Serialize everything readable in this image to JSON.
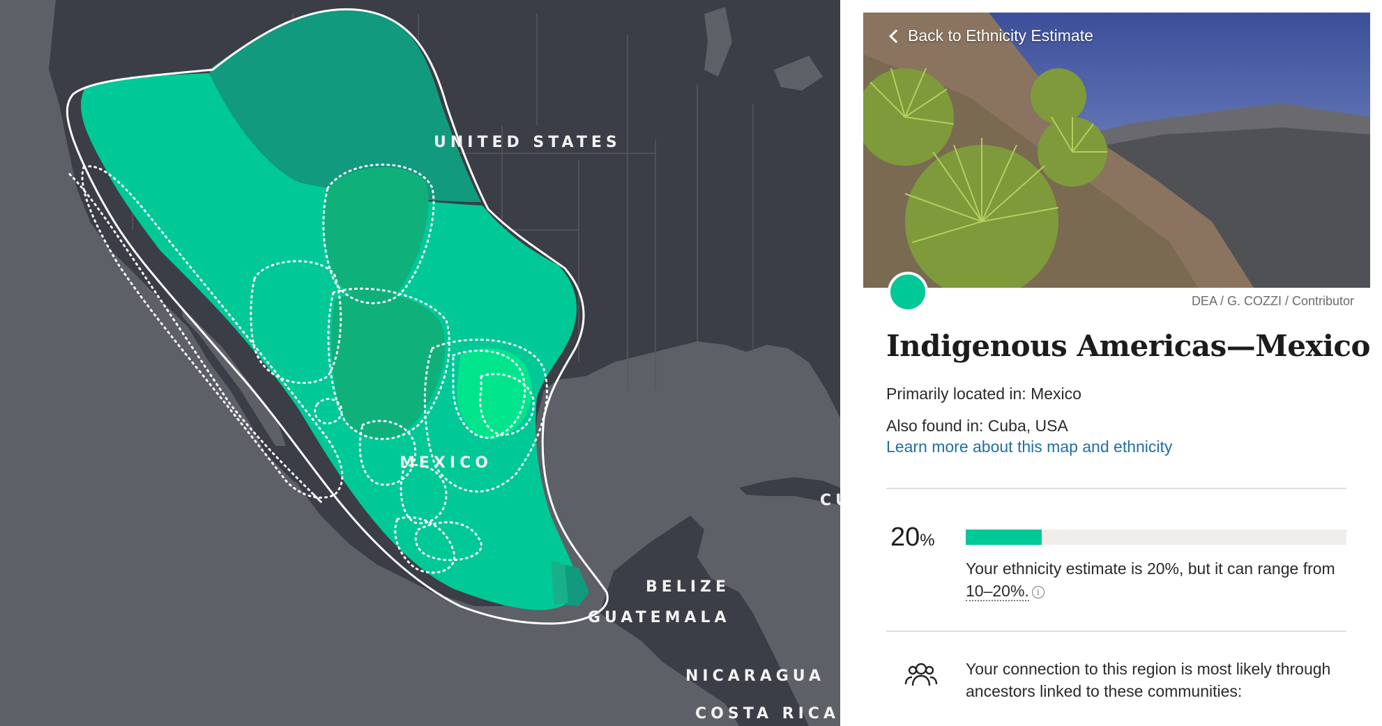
{
  "map": {
    "labels": {
      "united_states": "UNITED STATES",
      "mexico": "MEXICO",
      "belize": "BELIZE",
      "guatemala": "GUATEMALA",
      "nicaragua": "NICARAGUA",
      "costa_rica": "COSTA RICA",
      "cuba_partial": "CU"
    },
    "colors": {
      "land": "#3b3e46",
      "water": "#5d6067",
      "region": "#00c896",
      "region_dark": "#119a7e",
      "outline": "#ffffff"
    }
  },
  "panel": {
    "back_label": "Back to Ethnicity Estimate",
    "photo_credit": "DEA / G. COZZI / Contributor",
    "title": "Indigenous Americas—Mexico",
    "primary_location": "Primarily located in: Mexico",
    "also_found": "Also found in: Cuba, USA",
    "learn_more": "Learn more about this map and ethnicity",
    "estimate": {
      "percent_value": "20",
      "percent_sign": "%",
      "fill_fraction": 0.2,
      "range_text_1": "Your ethnicity estimate is 20%, but it can range from",
      "range_value": "10–20%.",
      "info_icon_glyph": "i"
    },
    "connection_text": "Your connection to this region is most likely through ancestors linked to these communities:",
    "accent_color": "#00c896"
  }
}
